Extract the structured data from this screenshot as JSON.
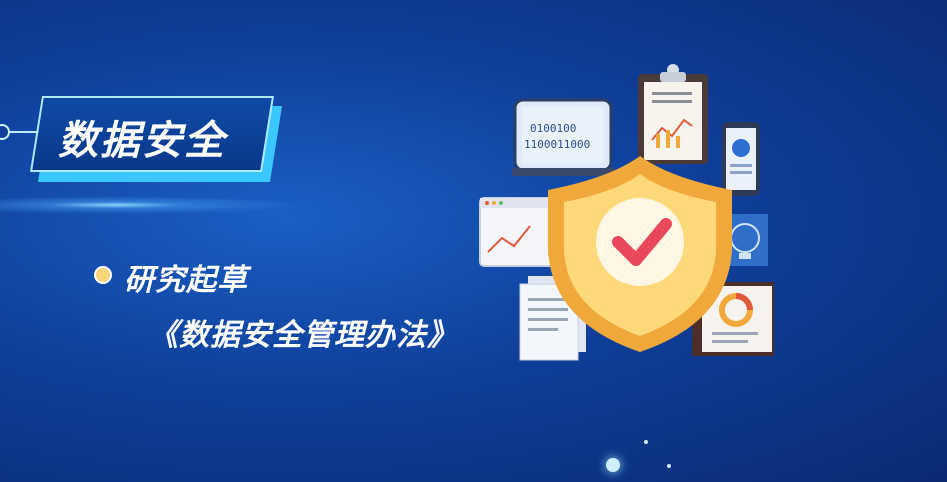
{
  "title": "数据安全",
  "subtitle_line1": "研究起草",
  "subtitle_line2": "《数据安全管理办法》",
  "binary_code": {
    "line1": "0100100",
    "line2": "1100011000"
  },
  "colors": {
    "background": "#0f3f9a",
    "title_accent": "#39c7ff",
    "bullet": "#f7d77a",
    "shield_outer": "#f0a83a",
    "shield_inner": "#ffd87a",
    "check": "#e8485a"
  }
}
